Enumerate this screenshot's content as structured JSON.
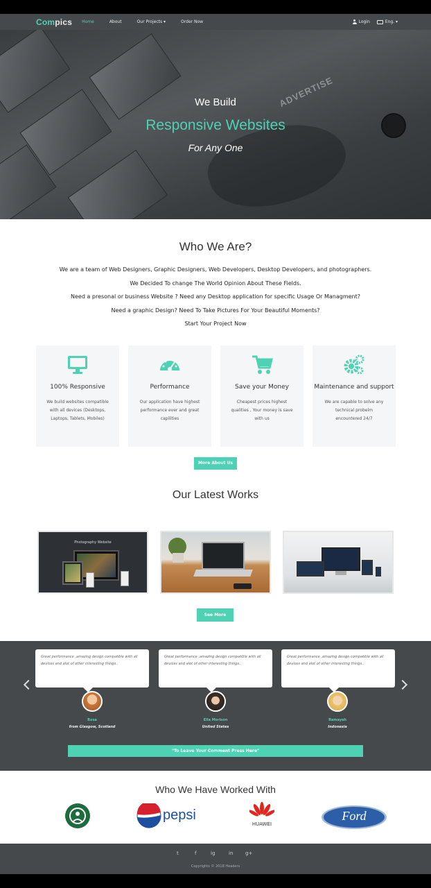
{
  "nav": {
    "brand_accent": "Com",
    "brand_rest": "pics",
    "links": [
      "Home",
      "About",
      "Our Projects ▾",
      "Order Now"
    ],
    "login": "Login",
    "lang": "Eng. ▾"
  },
  "hero": {
    "line1": "We Build",
    "line2": "Responsive Websites",
    "line3": "For Any One",
    "bg_word": "ADVERTISE"
  },
  "who": {
    "title": "Who We Are?",
    "lines": [
      "We are a team of Web Designers, Graphic Designers, Web Developers, Desktop Developers, and photographers.",
      "We Decided To change The World Opinion About These Fields.",
      "Need a presonal or business Website ? Need any Desktop application for specific Usage Or Managment?",
      "Need a graphic Design? Need To Take Pictures For Your Beautiful Moments?",
      "Start Your Project Now"
    ]
  },
  "features": [
    {
      "title": "100% Responsive",
      "desc": "We build websites compatible with all devices (Desktops, Laptops, Tablets, Mobiles)",
      "icon": "monitor-icon"
    },
    {
      "title": "Performance",
      "desc": "Our application have highest performance ever and great capilities",
      "icon": "speedometer-icon"
    },
    {
      "title": "Save your Money",
      "desc": "Cheapest prices highest qualities , Your money is save with us",
      "icon": "shopping-cart-icon"
    },
    {
      "title": "Maintenance and support",
      "desc": "We are capable to solve any technical probelm encountered 24/7",
      "icon": "gears-icon"
    }
  ],
  "buttons": {
    "more_about": "More About Us",
    "see_more": "See More",
    "leave_comment": "\"To Leave Your Comment Press Here\""
  },
  "works": {
    "title": "Our Latest Works",
    "items": [
      {
        "caption": "Photography Website"
      },
      {
        "caption": ""
      },
      {
        "caption": ""
      }
    ]
  },
  "testimonials": [
    {
      "quote": "Great performance ,amazing design compatible with all devices and alot of other interesting things..",
      "name": "Rosa",
      "location": "from Glasgow, Scotland"
    },
    {
      "quote": "Great performance ,amazing design compatible with all devices and alot of other interesting things..",
      "name": "Ella Morison",
      "location": "United States"
    },
    {
      "quote": "Great performance ,amazing design compatible with all devices and alot of other interesting things..",
      "name": "Ramayah",
      "location": "Indonesia"
    }
  ],
  "partners": {
    "title": "Who We Have Worked With",
    "logos": [
      "starbucks-logo",
      "pepsi-logo",
      "huawei-logo",
      "ford-logo"
    ],
    "pepsi_text": "pepsi",
    "huawei_text": "HUAWEI",
    "ford_text": "Ford"
  },
  "footer": {
    "social": [
      "t",
      "f",
      "ig",
      "in",
      "g+"
    ],
    "copyright": "Copyrights © 2018 Headers"
  },
  "colors": {
    "accent": "#4fd1b4",
    "dark": "#45494c"
  }
}
